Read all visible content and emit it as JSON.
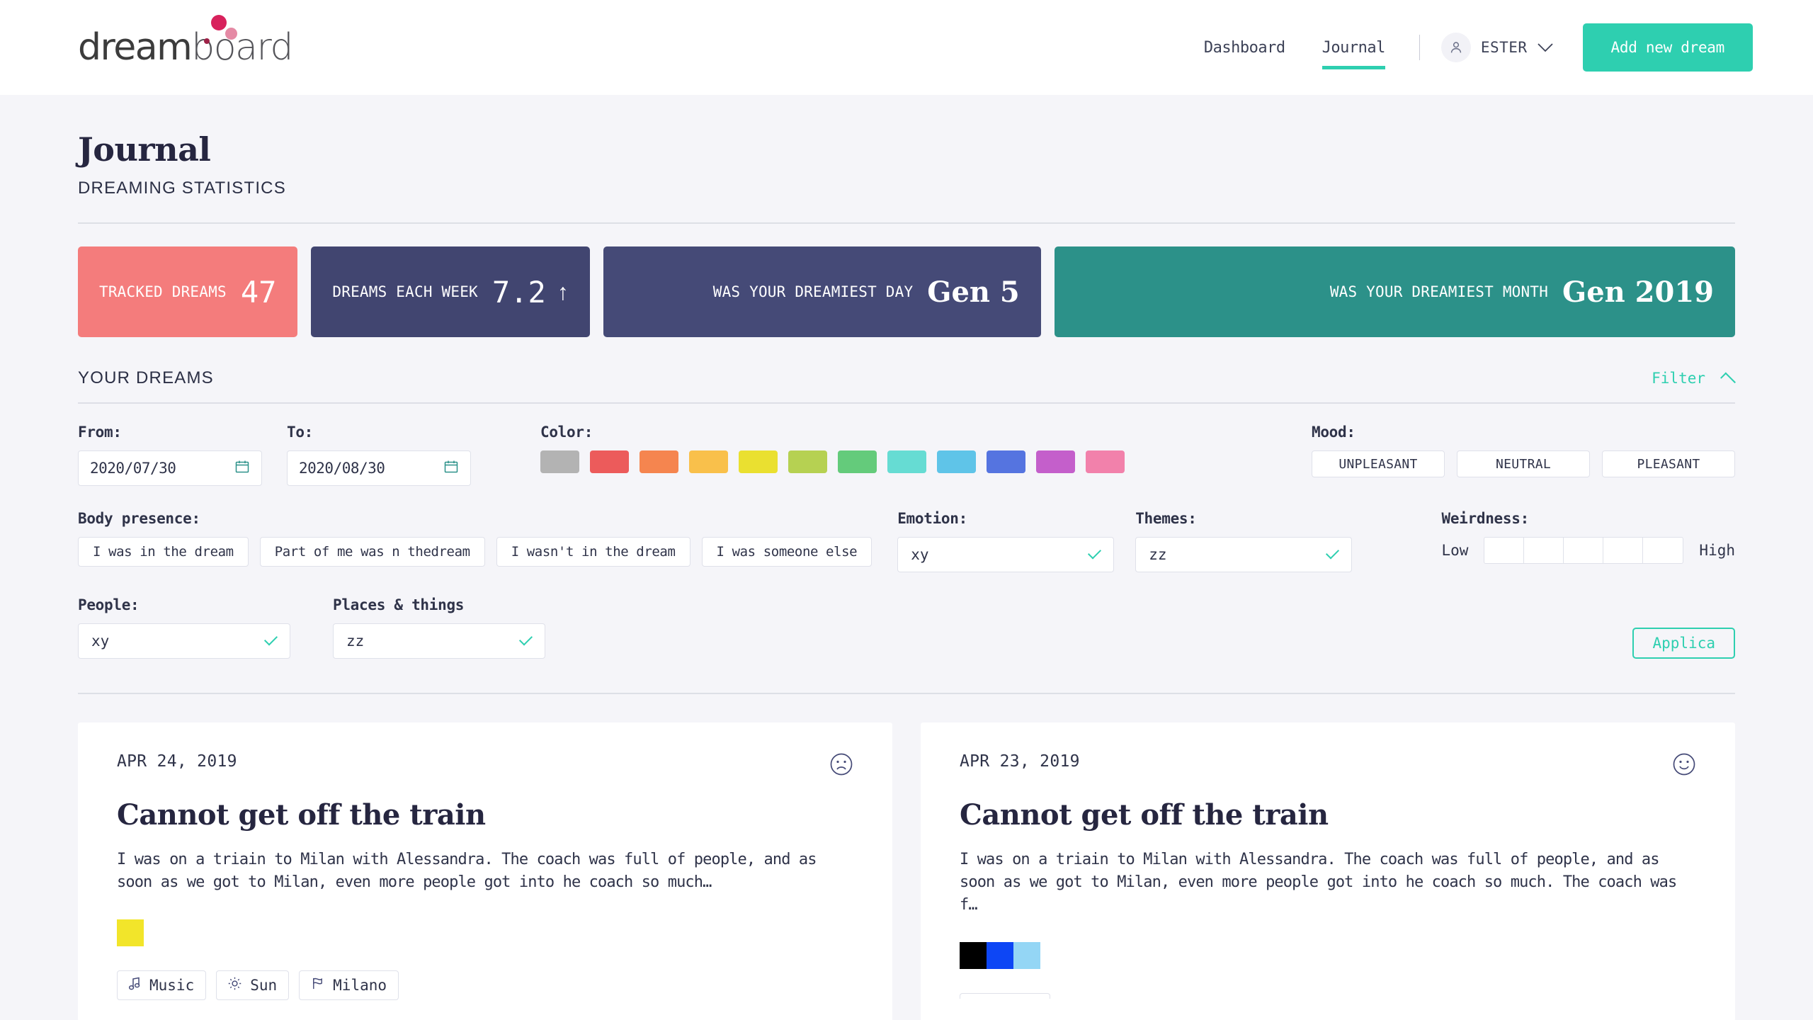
{
  "brand": {
    "name_bold": "dream",
    "name_light": "board"
  },
  "header": {
    "nav": [
      {
        "label": "Dashboard",
        "active": false
      },
      {
        "label": "Journal",
        "active": true
      }
    ],
    "user": {
      "name": "ESTER",
      "avatar_icon": "user-icon",
      "chevron_icon": "chevron-down-icon"
    },
    "add_dream_label": "Add new dream",
    "accent": "#2ecfb0"
  },
  "page": {
    "title": "Journal",
    "subtitle": "DREAMING STATISTICS"
  },
  "stats": [
    {
      "label": "TRACKED DREAMS",
      "value": "47",
      "bg": "#f47c7c",
      "trend": ""
    },
    {
      "label": "DREAMS EACH WEEK",
      "value": "7.2",
      "bg": "#414570",
      "trend": "↑"
    },
    {
      "label": "WAS YOUR DREAMIEST DAY",
      "value": "Gen 5",
      "bg": "#454a77",
      "trend": ""
    },
    {
      "label": "WAS YOUR DREAMIEST MONTH",
      "value": "Gen 2019",
      "bg": "#2c9189",
      "trend": ""
    }
  ],
  "dreams_section": {
    "title": "YOUR DREAMS",
    "filter_label": "Filter",
    "filter_chevron_icon": "chevron-up-icon"
  },
  "filters": {
    "from": {
      "label": "From:",
      "value": "2020/07/30",
      "icon": "calendar-icon"
    },
    "to": {
      "label": "To:",
      "value": "2020/08/30",
      "icon": "calendar-icon"
    },
    "color": {
      "label": "Color:",
      "swatches": [
        "#b3b3b3",
        "#ec5b5b",
        "#f5854f",
        "#f9c04b",
        "#eae030",
        "#b6d152",
        "#64cb7b",
        "#66dcd3",
        "#5fc4e8",
        "#5574e0",
        "#c45fcb",
        "#f281ab"
      ]
    },
    "mood": {
      "label": "Mood:",
      "options": [
        "UNPLEASANT",
        "NEUTRAL",
        "PLEASANT"
      ]
    },
    "body_presence": {
      "label": "Body presence:",
      "options": [
        "I was in the dream",
        "Part of me was n thedream",
        "I wasn't in the dream",
        "I was someone else"
      ]
    },
    "emotion": {
      "label": "Emotion:",
      "value": "xy"
    },
    "themes": {
      "label": "Themes:",
      "value": "zz"
    },
    "weirdness": {
      "label": "Weirdness:",
      "low": "Low",
      "high": "High",
      "cells": 5
    },
    "people": {
      "label": "People:",
      "value": "xy"
    },
    "places": {
      "label": "Places & things",
      "value": "zz"
    },
    "apply_label": "Applica"
  },
  "dream_cards": [
    {
      "date": "APR 24, 2019",
      "mood_icon": "sad-face-icon",
      "title": "Cannot get off the train",
      "body": "I was on a triain to Milan with Alessandra. The coach was full of people, and as soon as we got to Milan, even more people got into he coach so much…",
      "colors": [
        "#f2e52a"
      ],
      "tags": [
        {
          "icon": "music-note-icon",
          "label": "Music"
        },
        {
          "icon": "sun-icon",
          "label": "Sun"
        },
        {
          "icon": "flag-icon",
          "label": "Milano"
        }
      ]
    },
    {
      "date": "APR 23, 2019",
      "mood_icon": "happy-face-icon",
      "title": "Cannot get off the train",
      "body": "I was on a triain to Milan with Alessandra. The coach was full of people, and as soon as we got to Milan, even more people got into he coach so much. The coach was f…",
      "colors": [
        "#000000",
        "#0d46f5",
        "#94d6f5"
      ],
      "tags": []
    }
  ]
}
